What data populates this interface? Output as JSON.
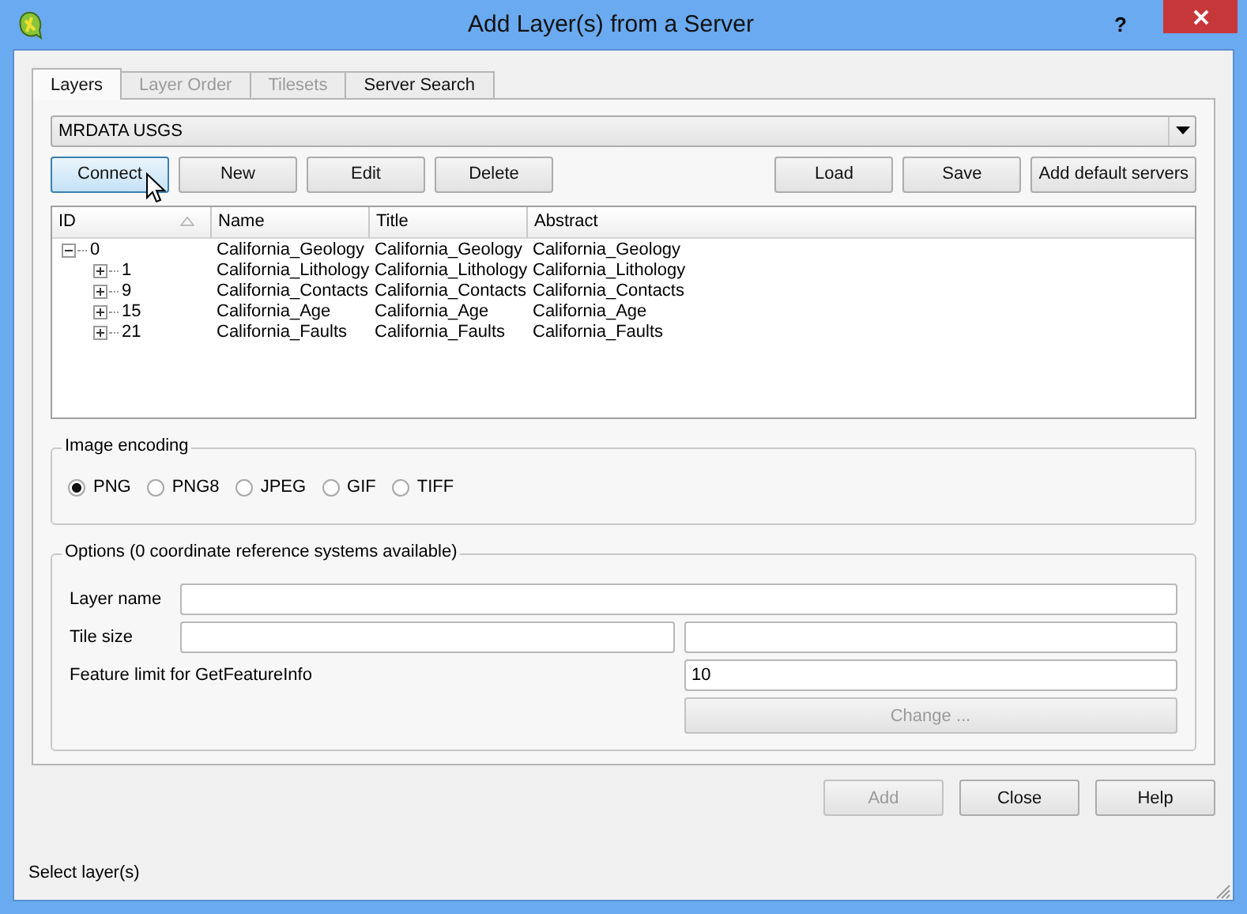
{
  "window": {
    "title": "Add Layer(s) from a Server",
    "help": "?"
  },
  "tabs": [
    {
      "label": "Layers",
      "selected": true,
      "disabled": false
    },
    {
      "label": "Layer Order",
      "selected": false,
      "disabled": true
    },
    {
      "label": "Tilesets",
      "selected": false,
      "disabled": true
    },
    {
      "label": "Server Search",
      "selected": false,
      "disabled": false
    }
  ],
  "server": {
    "value": "MRDATA USGS"
  },
  "server_buttons_left": [
    {
      "label": "Connect",
      "focused": true
    },
    {
      "label": "New",
      "focused": false
    },
    {
      "label": "Edit",
      "focused": false
    },
    {
      "label": "Delete",
      "focused": false
    }
  ],
  "server_buttons_right": [
    {
      "label": "Load",
      "focused": false
    },
    {
      "label": "Save",
      "focused": false
    },
    {
      "label": "Add default servers",
      "focused": false
    }
  ],
  "table": {
    "columns": [
      {
        "label": "ID",
        "sorted": true
      },
      {
        "label": "Name",
        "sorted": false
      },
      {
        "label": "Title",
        "sorted": false
      },
      {
        "label": "Abstract",
        "sorted": false
      }
    ],
    "rows": [
      {
        "id": "0",
        "name": "California_Geology",
        "title": "California_Geology",
        "abstract": "California_Geology",
        "expanded": true,
        "children": [
          {
            "id": "1",
            "name": "California_Lithology",
            "title": "California_Lithology",
            "abstract": "California_Lithology",
            "expanded": false
          },
          {
            "id": "9",
            "name": "California_Contacts",
            "title": "California_Contacts",
            "abstract": "California_Contacts",
            "expanded": false
          },
          {
            "id": "15",
            "name": "California_Age",
            "title": "California_Age",
            "abstract": "California_Age",
            "expanded": false
          },
          {
            "id": "21",
            "name": "California_Faults",
            "title": "California_Faults",
            "abstract": "California_Faults",
            "expanded": false
          }
        ]
      }
    ]
  },
  "image_encoding": {
    "title": "Image encoding",
    "options": [
      {
        "label": "PNG",
        "selected": true
      },
      {
        "label": "PNG8",
        "selected": false
      },
      {
        "label": "JPEG",
        "selected": false
      },
      {
        "label": "GIF",
        "selected": false
      },
      {
        "label": "TIFF",
        "selected": false
      }
    ]
  },
  "options": {
    "title": "Options (0 coordinate reference systems available)",
    "layer_name": {
      "label": "Layer name"
    },
    "tile_size": {
      "label": "Tile size"
    },
    "feature_limit": {
      "label": "Feature limit for GetFeatureInfo",
      "value": "10"
    },
    "change_button": {
      "label": "Change ...",
      "disabled": true
    }
  },
  "buttons": [
    {
      "label": "Add",
      "disabled": true
    },
    {
      "label": "Close",
      "disabled": false
    },
    {
      "label": "Help",
      "disabled": false
    }
  ],
  "status_bar": "Select layer(s)"
}
